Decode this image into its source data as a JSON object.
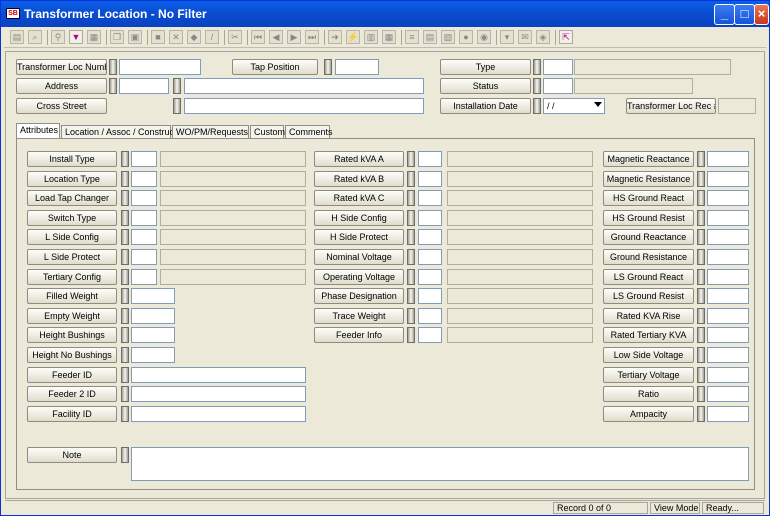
{
  "window": {
    "title": "Transformer Location - No Filter",
    "icon_label": "SB"
  },
  "toolbar": {
    "icons": [
      "form-icon",
      "search-icon",
      "record-find-icon",
      "filter-icon",
      "page-icon",
      "copy-icon",
      "paste-icon",
      "save-icon",
      "delete-icon",
      "stamp-icon",
      "edit-icon",
      "cut-icon",
      "first-icon",
      "prev-icon",
      "next-icon",
      "last-icon",
      "goto-icon",
      "lightning-icon",
      "report-icon",
      "grid-icon",
      "list-icon",
      "form2-icon",
      "chart-icon",
      "attach-icon",
      "globe-icon",
      "dropdown-icon",
      "mail-icon",
      "book-icon",
      "exit-icon"
    ]
  },
  "header": {
    "transformer_loc_number": {
      "label": "Transformer Loc Number",
      "value": ""
    },
    "tap_position": {
      "label": "Tap Position",
      "value": ""
    },
    "type": {
      "label": "Type",
      "value": "",
      "desc": ""
    },
    "address": {
      "label": "Address",
      "num": "",
      "street": ""
    },
    "status": {
      "label": "Status",
      "value": "",
      "desc": ""
    },
    "cross_street": {
      "label": "Cross Street",
      "value": ""
    },
    "installation_date": {
      "label": "Installation Date",
      "value": " / /"
    },
    "transformer_loc_rec": {
      "label": "Transformer Loc Rec #",
      "value": ""
    }
  },
  "tabs": [
    "Attributes",
    "Location / Assoc / Construct",
    "WO/PM/Requests",
    "Custom",
    "Comments"
  ],
  "attributes": {
    "col1": [
      "Install Type",
      "Location Type",
      "Load Tap Changer",
      "Switch Type",
      "L Side Config",
      "L Side Protect",
      "Tertiary Config",
      "Filled Weight",
      "Empty Weight",
      "Height Bushings",
      "Height No Bushings",
      "Feeder ID",
      "Feeder 2 ID",
      "Facility ID"
    ],
    "col2": [
      "Rated kVA A",
      "Rated kVA B",
      "Rated kVA C",
      "H Side Config",
      "H Side Protect",
      "Nominal Voltage",
      "Operating Voltage",
      "Phase Designation",
      "Trace Weight",
      "Feeder Info"
    ],
    "col3": [
      "Magnetic Reactance",
      "Magnetic Resistance",
      "HS Ground React",
      "HS Ground Resist",
      "Ground Reactance",
      "Ground Resistance",
      "LS Ground React",
      "LS Ground Resist",
      "Rated KVA Rise",
      "Rated Tertiary KVA",
      "Low Side Voltage",
      "Tertiary Voltage",
      "Ratio",
      "Ampacity"
    ],
    "note_label": "Note"
  },
  "statusbar": {
    "record": "Record 0 of 0",
    "mode": "View Mode",
    "state": "Ready..."
  }
}
